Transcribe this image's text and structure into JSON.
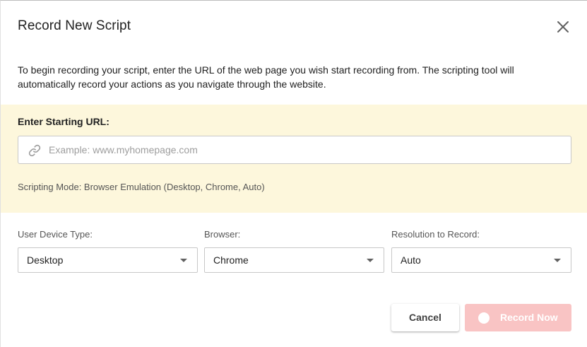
{
  "dialog": {
    "title": "Record New Script",
    "intro": "To begin recording your script, enter the URL of the web page you wish start recording from. The scripting tool will automatically record your actions as you navigate through the website."
  },
  "url_panel": {
    "label": "Enter Starting URL:",
    "value": "",
    "placeholder": "Example: www.myhomepage.com",
    "icon": "link-icon",
    "mode_text": "Scripting Mode: Browser Emulation (Desktop, Chrome, Auto)"
  },
  "selects": {
    "device": {
      "label": "User Device Type:",
      "value": "Desktop"
    },
    "browser": {
      "label": "Browser:",
      "value": "Chrome"
    },
    "resolution": {
      "label": "Resolution to Record:",
      "value": "Auto"
    }
  },
  "buttons": {
    "cancel": "Cancel",
    "record": "Record Now"
  },
  "colors": {
    "panel_background": "#fdf7dc",
    "record_button_disabled": "#f9c4c4"
  }
}
